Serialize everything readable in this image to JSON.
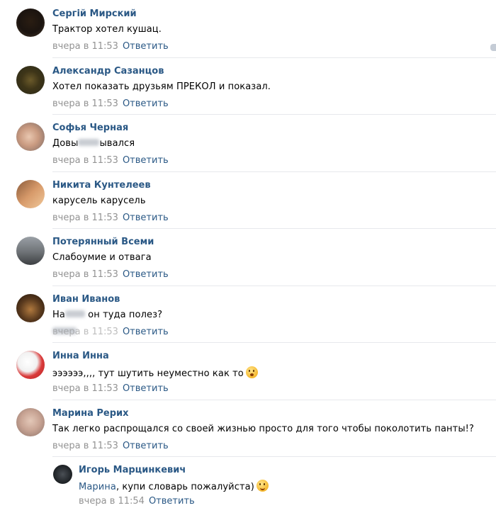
{
  "comments": [
    {
      "author": "Сергій Мирский",
      "text": "Трактор хотел кушац.",
      "time": "вчера в 11:53",
      "reply": "Ответить"
    },
    {
      "author": "Александр Сазанцов",
      "text": "Хотел показать друзьям ПРЕКОЛ и показал.",
      "time": "вчера в 11:53",
      "reply": "Ответить"
    },
    {
      "author": "Софья Черная",
      "text_before": "Довы",
      "text_after": "ывался",
      "time": "вчера в 11:53",
      "reply": "Ответить"
    },
    {
      "author": "Никита Кунтелеев",
      "text": "карусель карусель",
      "time": "вчера в 11:53",
      "reply": "Ответить"
    },
    {
      "author": "Потерянный Всеми",
      "text": "Слабоумие и отвага",
      "time": "вчера в 11:53",
      "reply": "Ответить"
    },
    {
      "author": "Иван Иванов",
      "text_before": "На",
      "text_after": " он туда полез?",
      "time": "вчера в 11:53",
      "reply": "Ответить"
    },
    {
      "author": "Инна Инна",
      "text": "ээээээ,,,, тут шутить неуместно как то",
      "emoji": "astonished-emoji",
      "time": "вчера в 11:53",
      "reply": "Ответить"
    },
    {
      "author": "Марина Рерих",
      "text": "Так легко распрощался со своей жизнью просто для того чтобы поколотить панты!?",
      "time": "вчера в 11:53",
      "reply": "Ответить"
    }
  ],
  "nested_reply": {
    "author": "Игорь Марцинкевич",
    "mention": "Марина",
    "text": ", купи словарь пожалуйста)",
    "emoji": "wink-emoji",
    "time": "вчера в 11:54",
    "reply": "Ответить"
  },
  "colors": {
    "link": "#2a5885",
    "meta": "#939393",
    "divider": "#e7e8ec"
  }
}
